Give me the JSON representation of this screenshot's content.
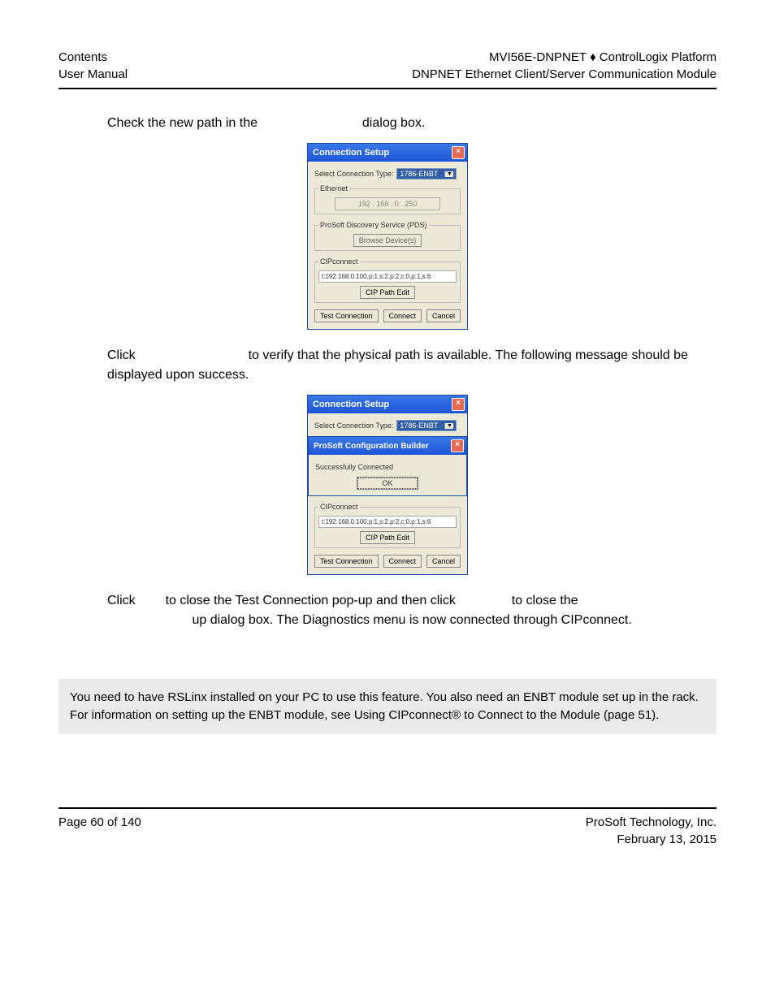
{
  "header": {
    "left_line1": "Contents",
    "left_line2": "User Manual",
    "right_line1": "MVI56E-DNPNET ♦ ControlLogix Platform",
    "right_line2": "DNPNET Ethernet Client/Server Communication Module"
  },
  "para1": "Check the new path in the ",
  "para1_b": " dialog box.",
  "dialog1": {
    "title": "Connection Setup",
    "select_label": "Select Connection Type:",
    "select_value": "1786-ENBT",
    "ethernet_legend": "Ethernet",
    "ip": "192 . 168 .  0  . 250",
    "pds_legend": "ProSoft Discovery Service (PDS)",
    "pds_button": "Browse Device(s)",
    "cip_legend": "CIPconnect",
    "cip_path": "t:192.168.0.100,p:1,s:2,p:2,c:0,p:1,s:6",
    "cip_edit": "CIP Path Edit",
    "test": "Test Connection",
    "connect": "Connect",
    "cancel": "Cancel"
  },
  "para2_a": "Click ",
  "para2_b": " to verify that the physical path is available. The following message should be displayed upon success.",
  "dialog2": {
    "title": "Connection Setup",
    "select_label": "Select Connection Type:",
    "select_value": "1786-ENBT",
    "popup_title": "ProSoft Configuration Builder",
    "popup_msg": "Successfully Connected",
    "popup_ok": "OK",
    "cip_legend": "CIPconnect",
    "cip_path": "t:192.168.0.100,p:1,s:2,p:2,c:0,p:1,s:6",
    "cip_edit": "CIP Path Edit",
    "test": "Test Connection",
    "connect": "Connect",
    "cancel": "Cancel"
  },
  "para3_a": "Click ",
  "para3_b": " to close the Test Connection pop-up and then click ",
  "para3_c": " to close the ",
  "para3_d": " up dialog box. The Diagnostics menu is now connected through CIPconnect.",
  "note": "You need to have RSLinx installed on your PC to use this feature. You also need an ENBT module set up in the rack. For information on setting up the ENBT module, see Using CIPconnect® to Connect to the Module (page 51).",
  "footer": {
    "left": "Page 60 of 140",
    "right_line1": "ProSoft Technology, Inc.",
    "right_line2": "February 13, 2015"
  }
}
